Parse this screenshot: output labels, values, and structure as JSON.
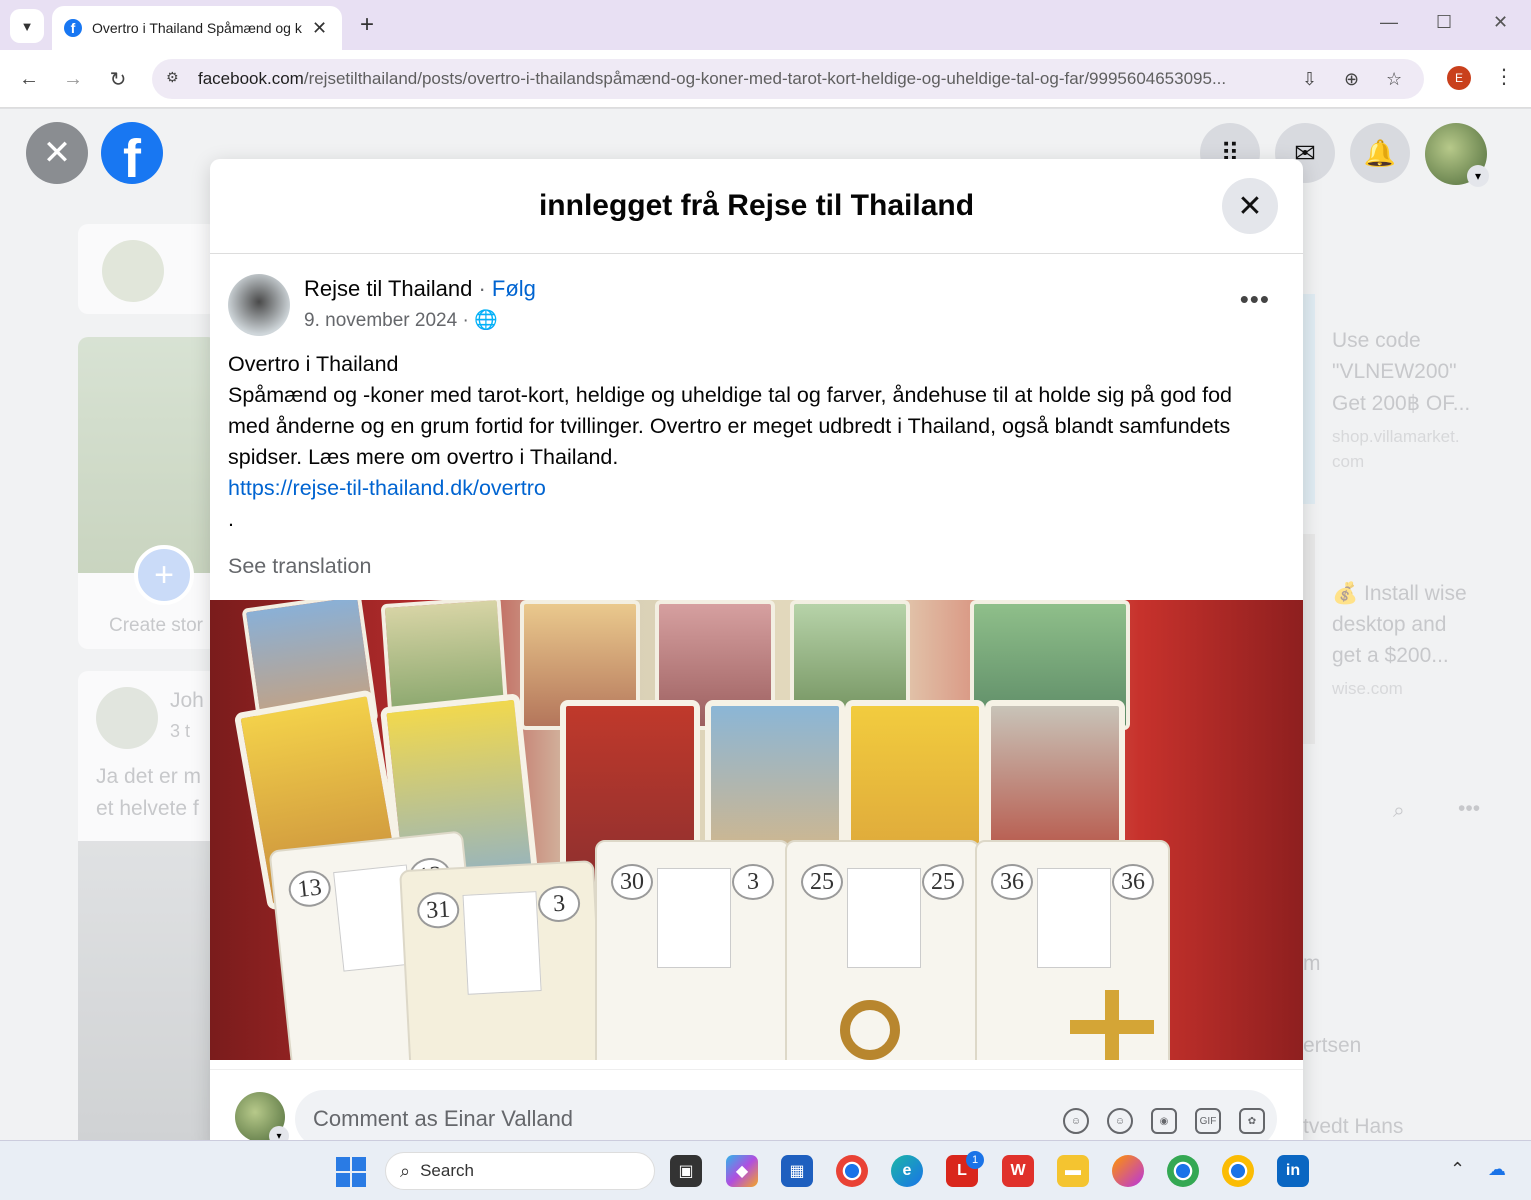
{
  "browser": {
    "tab_title": "Overtro i Thailand Spåmænd og koner med tarot-kort",
    "tab_close": "✕",
    "new_tab": "+",
    "url_host": "facebook.com",
    "url_path": "/rejsetilthailand/posts/overtro-i-thailandspåmænd-og-koner-med-tarot-kort-heldige-og-uheldige-tal-og-far/9995604653095...",
    "profile_initial": "E"
  },
  "facebook": {
    "modal_title": "innlegget frå Rejse til Thailand",
    "post": {
      "author": "Rejse til Thailand",
      "separator": " · ",
      "follow": "Følg",
      "date": "9. november 2024 · ",
      "line1": "Overtro i Thailand",
      "line2": "Spåmænd og -koner med tarot-kort, heldige og uheldige tal og farver, åndehuse til at holde sig på god fod med ånderne og en grum fortid for tvillinger. Overtro er meget udbredt i Thailand, også blandt samfundets spidser. Læs mere om overtro i Thailand.",
      "link": "https://rejse-til-thailand.dk/overtro",
      "dot": ".",
      "see_translation": "See translation"
    },
    "image_card_numbers": [
      "13",
      "13",
      "31",
      "3",
      "30",
      "3",
      "25",
      "25",
      "36",
      "36"
    ],
    "comment_placeholder": "Comment as Einar Valland",
    "background": {
      "create_story": "Create stor",
      "comment_author": "Joh",
      "comment_time": "3 t",
      "comment_text1": "Ja det er m",
      "comment_text2": "et helvete f",
      "ad1_line1": "Use code",
      "ad1_line2": "\"VLNEW200\"",
      "ad1_line3": "Get 200฿ OF...",
      "ad1_domain1": "shop.villamarket.",
      "ad1_domain2": "com",
      "ad2_line1": "Install wise",
      "ad2_line2": "desktop and",
      "ad2_line3": "get a $200...",
      "ad2_domain": "wise.com",
      "contact1": "m",
      "contact2": "ertsen",
      "contact3": "tvedt Hans"
    }
  },
  "taskbar": {
    "search_label": "Search",
    "notification_count": "1"
  }
}
